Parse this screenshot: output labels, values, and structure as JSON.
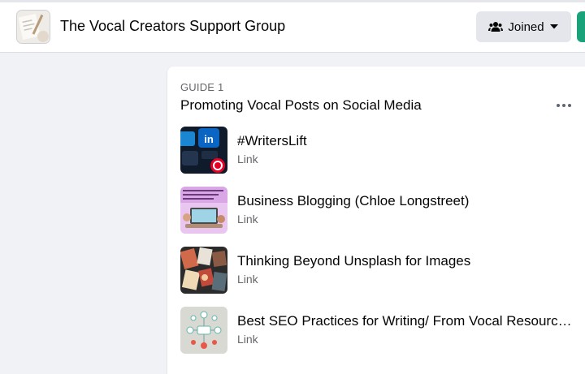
{
  "header": {
    "group_name": "The Vocal Creators Support Group",
    "joined_label": "Joined"
  },
  "guide": {
    "label": "GUIDE 1",
    "title": "Promoting Vocal Posts on Social Media",
    "items": [
      {
        "title": "#WritersLift",
        "subtitle": "Link",
        "thumb_icon": "social-apps-icon"
      },
      {
        "title": "Business Blogging (Chloe Longstreet)",
        "subtitle": "Link",
        "thumb_icon": "blogging-laptop-icon"
      },
      {
        "title": "Thinking Beyond Unsplash for Images",
        "subtitle": "Link",
        "thumb_icon": "photo-collage-icon"
      },
      {
        "title": "Best SEO Practices for Writing/ From Vocal Resources",
        "subtitle": "Link",
        "thumb_icon": "seo-diagram-icon"
      }
    ]
  },
  "colors": {
    "accent_green": "#1aa37a",
    "page_background": "#f0f2f5",
    "secondary_text": "#65676b"
  }
}
